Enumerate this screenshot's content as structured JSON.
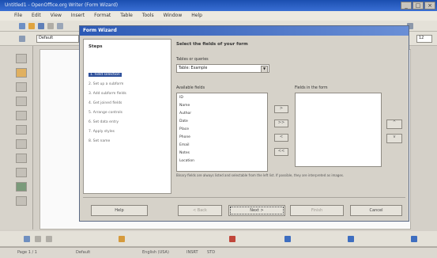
{
  "window": {
    "title": "Untitled1 - OpenOffice.org Writer (Form Wizard)",
    "controls": [
      "_",
      "□",
      "×"
    ]
  },
  "menubar": {
    "items": [
      "File",
      "Edit",
      "View",
      "Insert",
      "Format",
      "Table",
      "Tools",
      "Window",
      "Help"
    ]
  },
  "format_toolbar": {
    "style_value": "Default",
    "font_size_value": "12"
  },
  "wizard": {
    "title": "Form Wizard",
    "steps_heading": "Steps",
    "steps": [
      "1. Field selection",
      "2. Set up a subform",
      "3. Add subform fields",
      "4. Get joined fields",
      "5. Arrange controls",
      "6. Set data entry",
      "7. Apply styles",
      "8. Set name"
    ],
    "main_heading": "Select the fields of your form",
    "tables_label": "Tables or queries",
    "tables_value": "Table: Example",
    "available_label": "Available fields",
    "available_fields": [
      "ID",
      "Name",
      "Author",
      "Date",
      "Place",
      "Phone",
      "Email",
      "Notes",
      "Location"
    ],
    "selected_label": "Fields in the form",
    "move_buttons": [
      ">",
      ">>",
      "<",
      "<<"
    ],
    "order_buttons": [
      "^",
      "v"
    ],
    "hint": "Binary fields are always listed and selectable from the left list. If possible, they are interpreted as images.",
    "help_label": "Help",
    "back_label": "< Back",
    "next_label": "Next >",
    "finish_label": "Finish",
    "cancel_label": "Cancel"
  },
  "statusbar": {
    "page": "Page 1 / 1",
    "style": "Default",
    "language": "English (USA)",
    "mode": "INSRT",
    "selection": "STD"
  }
}
